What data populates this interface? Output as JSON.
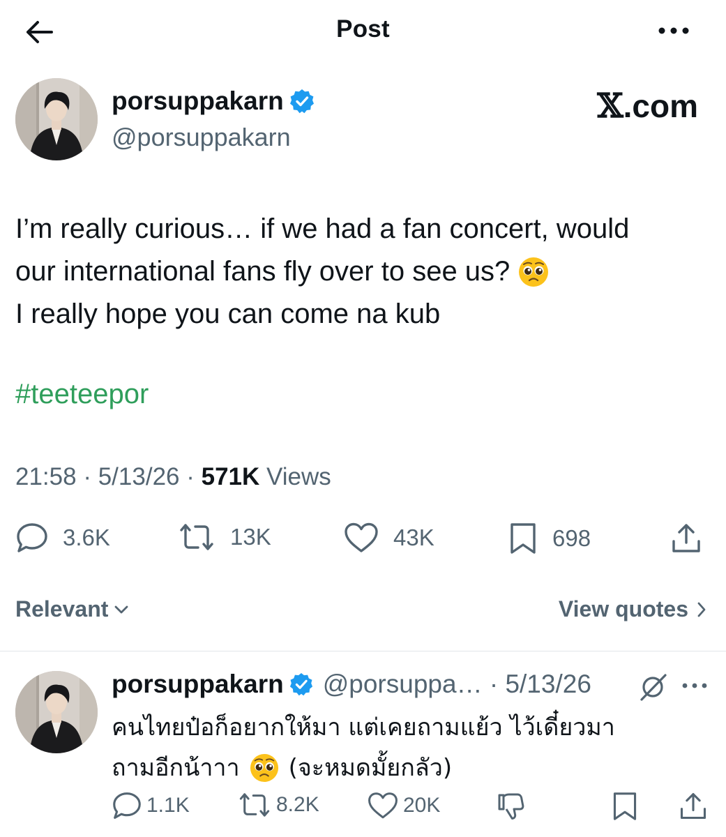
{
  "header": {
    "title": "Post"
  },
  "post": {
    "author_name": "porsuppakarn",
    "author_handle": "@porsuppakarn",
    "watermark": {
      "mark": "𝕏",
      "text": ".com"
    },
    "text_lines": [
      "I’m really curious… if we had a fan concert, would",
      "our international fans fly over to see us?",
      "I really hope you can come na kub"
    ],
    "hashtag": "#teeteepor",
    "time": "21:58",
    "date": "5/13/26",
    "separator": "·",
    "views_count": "571K",
    "views_label": "Views",
    "actions": {
      "replies": "3.6K",
      "reposts": "13K",
      "likes": "43K",
      "bookmarks": "698"
    }
  },
  "replies_bar": {
    "sort_label": "Relevant",
    "view_quotes_label": "View quotes"
  },
  "reply": {
    "author_name": "porsuppakarn",
    "handle_date": "@porsuppa… · 5/13/26",
    "text_line1": "คนไทยป๋อก็อยากให้มา แต่เคยถามแย้ว ไว้เดี๋ยวมา",
    "text_line2a": "ถามอีกน้าาา",
    "text_line2b": "(จะหมดมั้ยกลัว)",
    "actions": {
      "replies": "1.1K",
      "reposts": "8.2K",
      "likes": "20K"
    }
  },
  "colors": {
    "text": "#0f1419",
    "secondary": "#536471",
    "hashtag": "#2f9e5b",
    "verified": "#1d9bf0",
    "divider": "#e1e6ea"
  }
}
